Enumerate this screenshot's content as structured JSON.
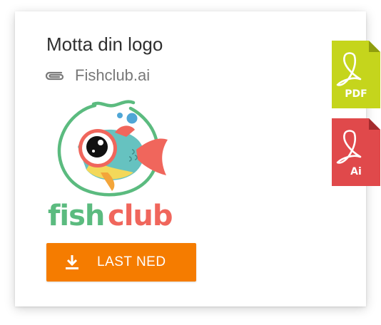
{
  "card": {
    "title": "Motta din logo",
    "file_name": "Fishclub.ai",
    "logo_alt": "FishClub"
  },
  "download": {
    "label": "LAST NED"
  },
  "formats": [
    {
      "label": "PDF",
      "color": "#c5d51c"
    },
    {
      "label": "Ai",
      "color": "#e0494b"
    }
  ],
  "colors": {
    "accent": "#f57c00",
    "logo_green": "#5bbb7f",
    "logo_red": "#f0665c"
  }
}
